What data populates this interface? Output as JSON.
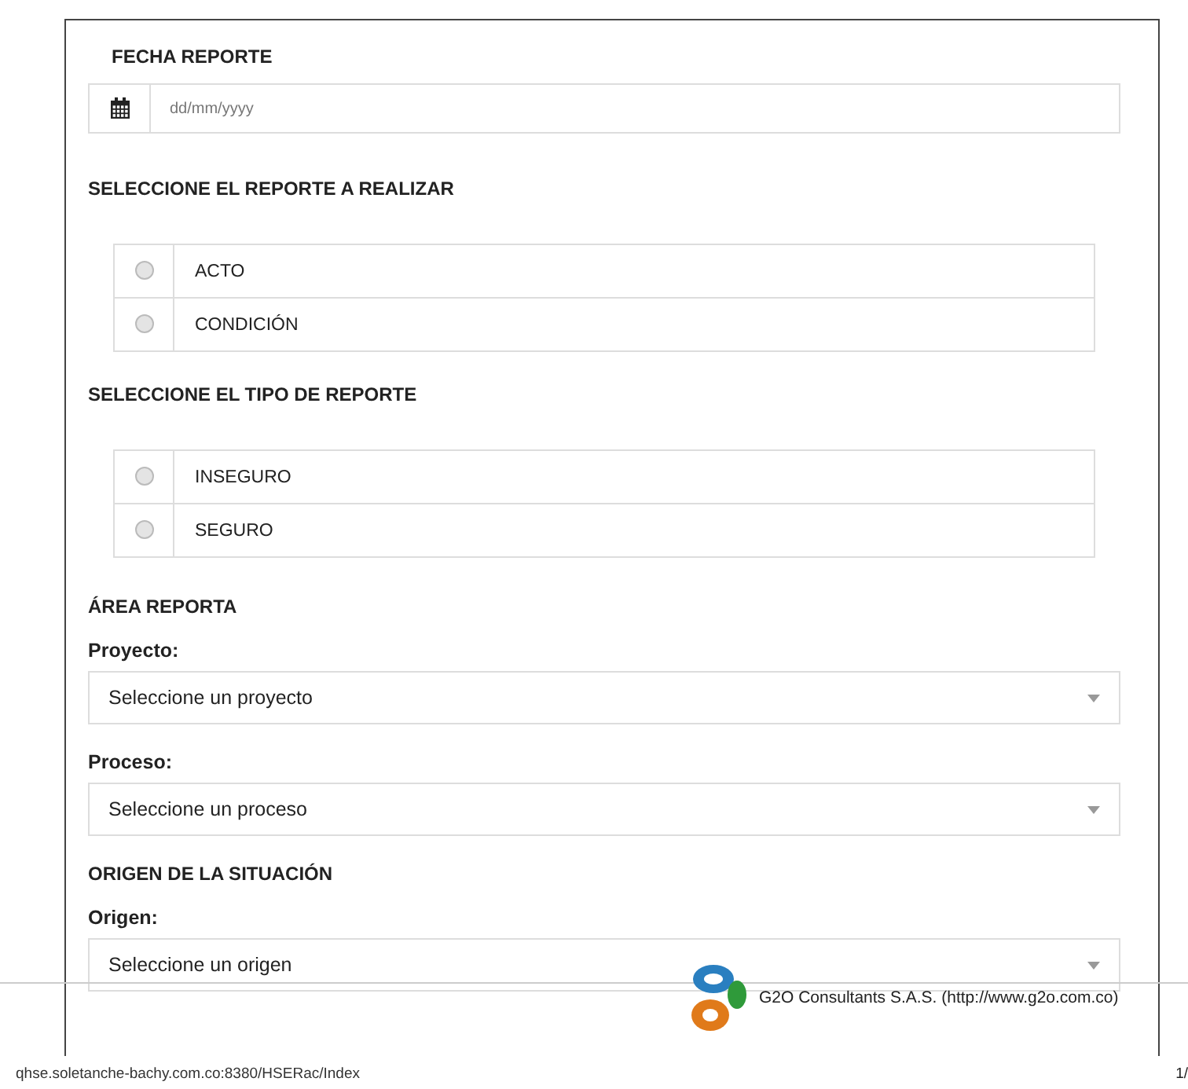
{
  "date_section": {
    "title": "FECHA REPORTE",
    "field": {
      "placeholder": "dd/mm/yyyy"
    }
  },
  "report_choice": {
    "title": "SELECCIONE EL REPORTE A REALIZAR",
    "options": [
      {
        "label": "ACTO",
        "selected": false
      },
      {
        "label": "CONDICIÓN",
        "selected": false
      }
    ]
  },
  "report_type": {
    "title": "SELECCIONE EL TIPO DE REPORTE",
    "options": [
      {
        "label": "INSEGURO",
        "selected": false
      },
      {
        "label": "SEGURO",
        "selected": false
      }
    ]
  },
  "area_section": {
    "title": "ÁREA REPORTA",
    "fields": [
      {
        "label": "Proyecto:",
        "value": "Seleccione un proyecto"
      },
      {
        "label": "Proceso:",
        "value": "Seleccione un proceso"
      }
    ]
  },
  "origin_section": {
    "title": "ORIGEN DE LA SITUACIÓN",
    "fields": [
      {
        "label": "Origen:",
        "value": "Seleccione un origen"
      }
    ]
  },
  "print_footer": {
    "credit": "G2O Consultants S.A.S. (http://www.g2o.com.co)",
    "url": "qhse.soletanche-bachy.com.co:8380/HSERac/Index",
    "page": "1/"
  }
}
